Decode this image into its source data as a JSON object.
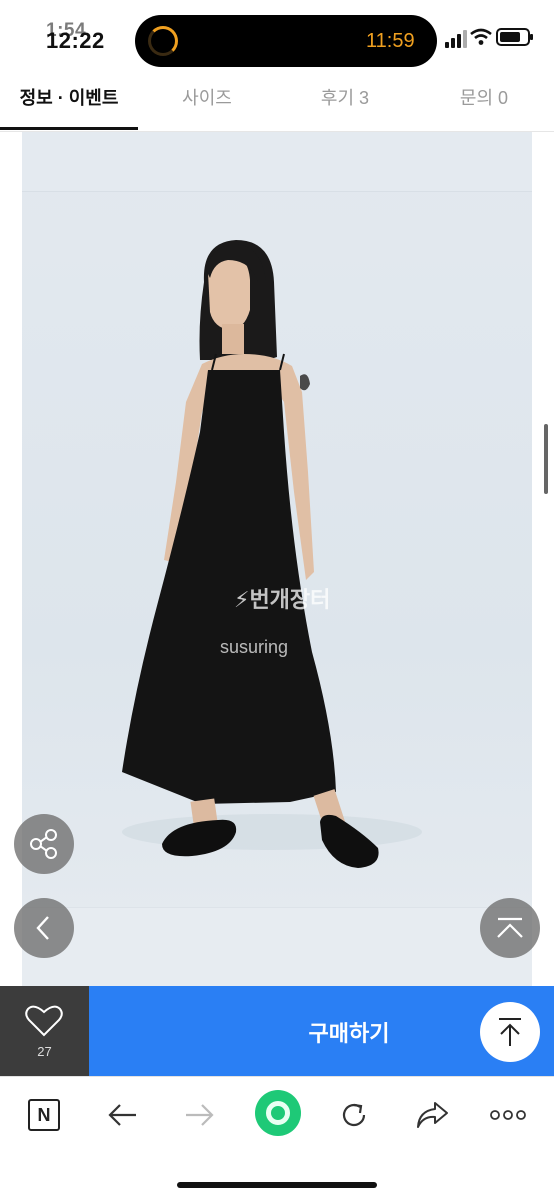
{
  "status_bar": {
    "time_primary": "12:22",
    "time_secondary": "1:54",
    "island_time": "11:59"
  },
  "tabs": [
    {
      "label": "정보 · 이벤트",
      "active": true
    },
    {
      "label": "사이즈",
      "active": false
    },
    {
      "label": "후기 3",
      "active": false
    },
    {
      "label": "문의 0",
      "active": false
    }
  ],
  "image": {
    "watermark_logo": "⚡번개장터",
    "watermark_user": "susuring"
  },
  "floating_buttons": {
    "share_icon": "share-icon",
    "prev_icon": "chevron-left-icon",
    "collapse_icon": "chevron-up-icon"
  },
  "purchase_bar": {
    "like_icon": "heart-icon",
    "like_count": "27",
    "buy_label": "구매하기",
    "scroll_top_icon": "arrow-up-to-top-icon",
    "buy_color": "#2a7ff4"
  },
  "browser_toolbar": {
    "items": [
      "naver-logo-icon",
      "back-arrow-icon",
      "forward-arrow-icon",
      "green-dot-icon",
      "reload-icon",
      "share-icon",
      "more-icon"
    ],
    "naver_letter": "N",
    "green_color": "#1ec977"
  }
}
